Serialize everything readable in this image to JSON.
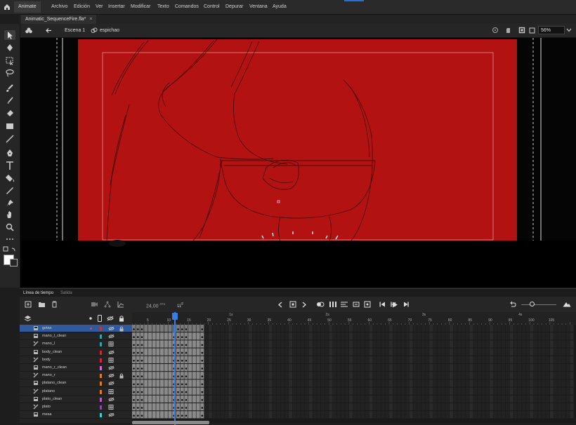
{
  "menubar": {
    "workspace": "Animate",
    "items": [
      "Archivo",
      "Edición",
      "Ver",
      "Insertar",
      "Modificar",
      "Texto",
      "Comandos",
      "Control",
      "Depurar",
      "Ventana",
      "Ayuda"
    ]
  },
  "document": {
    "tab_title": "Animatic_SequenceFire.fla*",
    "close": "×"
  },
  "scenebar": {
    "scene": "Escena 1",
    "symbol": "espichao",
    "zoom": "56%"
  },
  "timeline": {
    "tabs": [
      "Línea de tiempo",
      "Salida"
    ],
    "fps": "24,00",
    "fps_unit": "FPS",
    "current_frame": "11",
    "current_frame_unit": "F",
    "ruler_numbers": [
      "5",
      "10",
      "15",
      "20",
      "25",
      "30",
      "35",
      "40",
      "45",
      "50",
      "55",
      "60",
      "65",
      "70",
      "75",
      "80",
      "85",
      "90",
      "95",
      "100",
      "105"
    ],
    "ruler_seconds": [
      "1s",
      "2s",
      "3s",
      "4s"
    ],
    "layers": [
      {
        "name": "gotas",
        "color": "#c0392b",
        "active": true
      },
      {
        "name": "mano_l_clean",
        "color": "#2aa6a6"
      },
      {
        "name": "mano_l",
        "color": "#2aa6a6"
      },
      {
        "name": "body_clean",
        "color": "#d0282c"
      },
      {
        "name": "body",
        "color": "#d0282c"
      },
      {
        "name": "mano_r_clean",
        "color": "#d86ad8"
      },
      {
        "name": "mano_r",
        "color": "#e07b1d"
      },
      {
        "name": "platano_clean",
        "color": "#e07b1d"
      },
      {
        "name": "platano",
        "color": "#e07b1d"
      },
      {
        "name": "plato_clean",
        "color": "#b85cd6"
      },
      {
        "name": "plato",
        "color": "#8e44ad"
      },
      {
        "name": "mesa",
        "color": "#2ad7d7"
      }
    ]
  }
}
